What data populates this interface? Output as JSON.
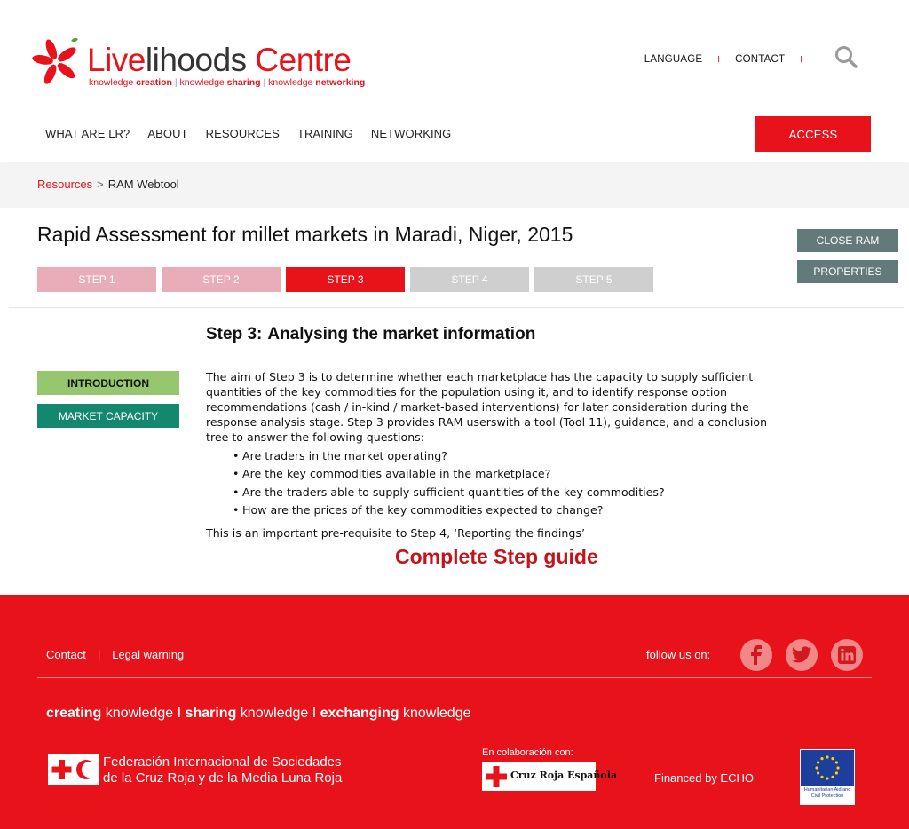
{
  "header": {
    "logo": {
      "name_part1": "Live",
      "name_part2": "lihoods",
      "name_part3": " Centre",
      "tag_k1": "knowledge ",
      "tag_b1": "creation",
      "tag_sep1": " | ",
      "tag_k2": "knowledge ",
      "tag_b2": "sharing",
      "tag_sep2": " | ",
      "tag_k3": "knowledge ",
      "tag_b3": "networking"
    },
    "links": {
      "language": "LANGUAGE",
      "separator1": "I",
      "contact": "CONTACT",
      "separator2": "I"
    },
    "search_icon": "search-icon"
  },
  "nav": {
    "items": [
      "WHAT ARE LR?",
      "ABOUT",
      "RESOURCES",
      "TRAINING",
      "NETWORKING"
    ],
    "access_label": "ACCESS"
  },
  "breadcrumb": {
    "parent": "Resources",
    "separator": ">",
    "current": "RAM Webtool"
  },
  "page": {
    "title": "Rapid Assessment for millet markets in Maradi, Niger, 2015",
    "close_label": "CLOSE RAM",
    "properties_label": "PROPERTIES",
    "steps": [
      {
        "label": "STEP 1",
        "state": "done"
      },
      {
        "label": "STEP 2",
        "state": "done"
      },
      {
        "label": "STEP 3",
        "state": "active"
      },
      {
        "label": "STEP 4",
        "state": "todo"
      },
      {
        "label": "STEP 5",
        "state": "todo"
      }
    ],
    "tabs": {
      "introduction": "INTRODUCTION",
      "market_capacity": "MARKET CAPACITY"
    },
    "step_heading": {
      "prefix": "Step 3:",
      "text": "Analysing the market information"
    },
    "intro_paragraph": "The aim of Step 3 is to determine whether each marketplace has the capacity to supply sufficient quantities of the key commodities for the population using it, and to identify response option recommendations (cash / in-kind / market-based interventions) for later consideration during the response analysis stage. Step 3 provides RAM userswith a tool (Tool 11), guidance, and a conclusion tree to answer the following questions:",
    "questions": [
      "Are traders in the market operating?",
      "Are the key commodities available in the marketplace?",
      "Are the traders able to supply sufficient quantities of the key commodities?",
      "How are the prices of the key commodities expected to change?"
    ],
    "closing": "This is an important pre-requisite to Step 4, ‘Reporting the findings’",
    "guide_link": "Complete Step guide"
  },
  "footer": {
    "contact": "Contact",
    "separator": "|",
    "legal": "Legal warning",
    "follow": "follow us on:",
    "social_icons": [
      "facebook-icon",
      "twitter-icon",
      "linkedin-icon"
    ],
    "tagline": {
      "b1": "creating",
      "t1": " knowledge",
      "s1": " I ",
      "b2": "sharing",
      "t2": " knowledge",
      "s2": " I ",
      "b3": "exchanging",
      "t3": " knowledge"
    },
    "ifrc_line1": "Federación Internacional de Sociedades",
    "ifrc_line2": "de la Cruz Roja y de la Media Luna Roja",
    "collab": "En colaboración con:",
    "cre_name": "Cruz Roja Española",
    "financed": "Financed by ECHO",
    "echo_text": "Humanitarian Aid and Civil Protection"
  },
  "colors": {
    "brand_red": "#e8121b",
    "step_done": "#e8adb8",
    "step_todo": "#cfcfcf",
    "slate": "#637a7a",
    "intro_green": "#96c66e",
    "teal": "#14886f"
  }
}
